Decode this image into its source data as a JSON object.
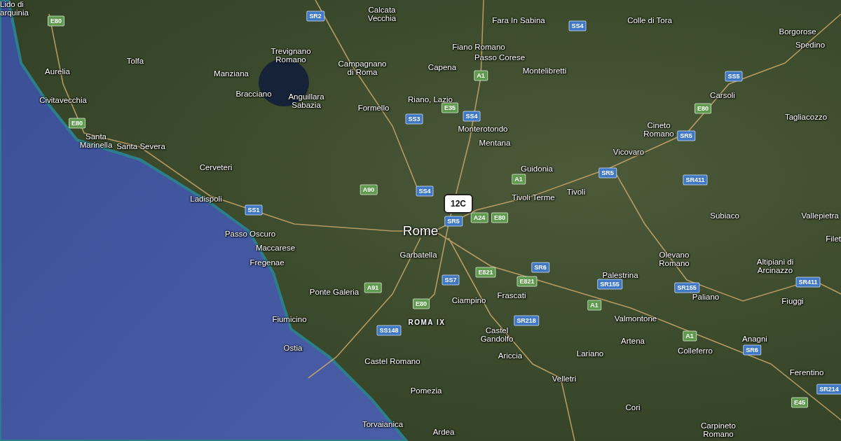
{
  "map": {
    "places": [
      {
        "name": "Lido di\narquinia",
        "kind": "town"
      },
      {
        "name": "Calcata\nVecchia",
        "kind": "town"
      },
      {
        "name": "Fara In Sabina",
        "kind": "town"
      },
      {
        "name": "Colle di Tora",
        "kind": "town"
      },
      {
        "name": "Borgorose",
        "kind": "town"
      },
      {
        "name": "Fiano Romano",
        "kind": "town"
      },
      {
        "name": "Spedino",
        "kind": "town"
      },
      {
        "name": "Tolfa",
        "kind": "town"
      },
      {
        "name": "Trevignano\nRomano",
        "kind": "town"
      },
      {
        "name": "Passo Corese",
        "kind": "town"
      },
      {
        "name": "Aurelia",
        "kind": "town"
      },
      {
        "name": "Manziana",
        "kind": "town"
      },
      {
        "name": "Campagnano\ndi Roma",
        "kind": "town"
      },
      {
        "name": "Capena",
        "kind": "town"
      },
      {
        "name": "Montelibretti",
        "kind": "town"
      },
      {
        "name": "Civitavecchia",
        "kind": "town"
      },
      {
        "name": "Bracciano",
        "kind": "town"
      },
      {
        "name": "Anguillara\nSabazia",
        "kind": "town"
      },
      {
        "name": "Riano, Lazio",
        "kind": "town"
      },
      {
        "name": "Carsoli",
        "kind": "town"
      },
      {
        "name": "Formello",
        "kind": "town"
      },
      {
        "name": "Tagliacozzo",
        "kind": "town"
      },
      {
        "name": "Monterotondo",
        "kind": "town"
      },
      {
        "name": "Cineto\nRomano",
        "kind": "town"
      },
      {
        "name": "Santa\nMarinella",
        "kind": "town"
      },
      {
        "name": "Santa Severa",
        "kind": "town"
      },
      {
        "name": "Mentana",
        "kind": "town"
      },
      {
        "name": "Vicovaro",
        "kind": "town"
      },
      {
        "name": "Cerveteri",
        "kind": "town"
      },
      {
        "name": "Guidonia",
        "kind": "town"
      },
      {
        "name": "Ladispoli",
        "kind": "town"
      },
      {
        "name": "Tivoli Terme",
        "kind": "town"
      },
      {
        "name": "Tivoli",
        "kind": "town"
      },
      {
        "name": "Subiaco",
        "kind": "town"
      },
      {
        "name": "Vallepietra",
        "kind": "town"
      },
      {
        "name": "Passo Oscuro",
        "kind": "town"
      },
      {
        "name": "Rome",
        "kind": "city"
      },
      {
        "name": "Filet",
        "kind": "town"
      },
      {
        "name": "Maccarese",
        "kind": "town"
      },
      {
        "name": "Fregenae",
        "kind": "town"
      },
      {
        "name": "Garbatella",
        "kind": "town"
      },
      {
        "name": "Olevano\nRomano",
        "kind": "town"
      },
      {
        "name": "Altipiani di\nArcinazzo",
        "kind": "town"
      },
      {
        "name": "Palestrina",
        "kind": "town"
      },
      {
        "name": "Ponte Galeria",
        "kind": "town"
      },
      {
        "name": "Ciampino",
        "kind": "town"
      },
      {
        "name": "Frascati",
        "kind": "town"
      },
      {
        "name": "Paliano",
        "kind": "town"
      },
      {
        "name": "Fiuggi",
        "kind": "town"
      },
      {
        "name": "Fiumicino",
        "kind": "town"
      },
      {
        "name": "ROMA IX",
        "kind": "district"
      },
      {
        "name": "Valmontone",
        "kind": "town"
      },
      {
        "name": "Castel\nGandolfo",
        "kind": "town"
      },
      {
        "name": "Artena",
        "kind": "town"
      },
      {
        "name": "Anagni",
        "kind": "town"
      },
      {
        "name": "Ostia",
        "kind": "town"
      },
      {
        "name": "Castel Romano",
        "kind": "town"
      },
      {
        "name": "Ariccia",
        "kind": "town"
      },
      {
        "name": "Lariano",
        "kind": "town"
      },
      {
        "name": "Colleferro",
        "kind": "town"
      },
      {
        "name": "Velletri",
        "kind": "town"
      },
      {
        "name": "Ferentino",
        "kind": "town"
      },
      {
        "name": "Pomezia",
        "kind": "town"
      },
      {
        "name": "Cori",
        "kind": "town"
      },
      {
        "name": "Torvaianica",
        "kind": "town"
      },
      {
        "name": "Ardea",
        "kind": "town"
      },
      {
        "name": "Carpineto\nRomano",
        "kind": "town"
      }
    ],
    "road_shields": [
      {
        "label": "E80",
        "kind": "motorway"
      },
      {
        "label": "SR2",
        "kind": "regional"
      },
      {
        "label": "SS4",
        "kind": "regional"
      },
      {
        "label": "A1",
        "kind": "motorway"
      },
      {
        "label": "E35",
        "kind": "motorway"
      },
      {
        "label": "SS4",
        "kind": "regional"
      },
      {
        "label": "SS3",
        "kind": "regional"
      },
      {
        "label": "SS5",
        "kind": "regional"
      },
      {
        "label": "E80",
        "kind": "motorway"
      },
      {
        "label": "E80",
        "kind": "motorway"
      },
      {
        "label": "SR5",
        "kind": "regional"
      },
      {
        "label": "SR5",
        "kind": "regional"
      },
      {
        "label": "A90",
        "kind": "motorway"
      },
      {
        "label": "SS4",
        "kind": "regional"
      },
      {
        "label": "A1",
        "kind": "motorway"
      },
      {
        "label": "SR411",
        "kind": "regional"
      },
      {
        "label": "SS1",
        "kind": "regional"
      },
      {
        "label": "SR5",
        "kind": "regional"
      },
      {
        "label": "A24",
        "kind": "motorway"
      },
      {
        "label": "E80",
        "kind": "motorway"
      },
      {
        "label": "E821",
        "kind": "motorway"
      },
      {
        "label": "SR6",
        "kind": "regional"
      },
      {
        "label": "E821",
        "kind": "motorway"
      },
      {
        "label": "SR155",
        "kind": "regional"
      },
      {
        "label": "SR155",
        "kind": "regional"
      },
      {
        "label": "SR411",
        "kind": "regional"
      },
      {
        "label": "A91",
        "kind": "motorway"
      },
      {
        "label": "SS7",
        "kind": "regional"
      },
      {
        "label": "E80",
        "kind": "motorway"
      },
      {
        "label": "A1",
        "kind": "motorway"
      },
      {
        "label": "SR218",
        "kind": "regional"
      },
      {
        "label": "SS148",
        "kind": "regional"
      },
      {
        "label": "A1",
        "kind": "motorway"
      },
      {
        "label": "SR6",
        "kind": "regional"
      },
      {
        "label": "SR214",
        "kind": "regional"
      },
      {
        "label": "E45",
        "kind": "motorway"
      }
    ],
    "marker": {
      "label": "12C"
    }
  }
}
